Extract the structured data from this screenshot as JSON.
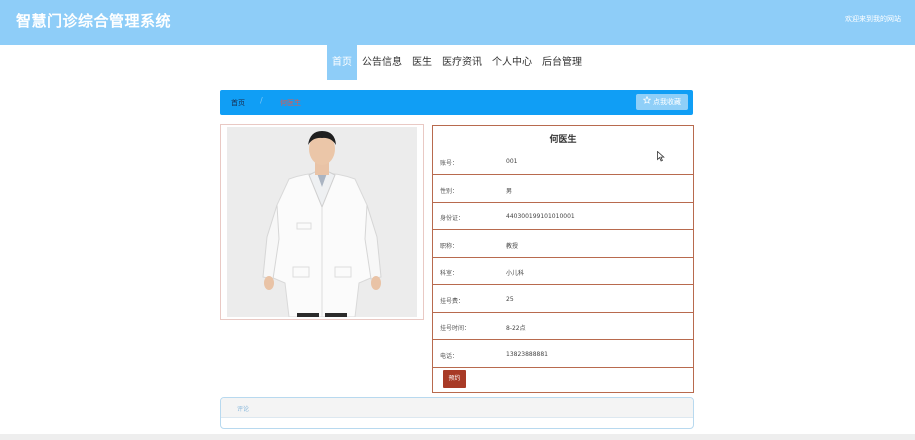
{
  "header": {
    "site_title": "智慧门诊综合管理系统",
    "welcome": "欢迎来到我的网站",
    "bg_color": "#8ecdf8"
  },
  "nav": {
    "items": [
      {
        "label": "首页",
        "active": true
      },
      {
        "label": "公告信息"
      },
      {
        "label": "医生"
      },
      {
        "label": "医疗资讯"
      },
      {
        "label": "个人中心"
      },
      {
        "label": "后台管理"
      }
    ]
  },
  "breadcrumb": {
    "home": "首页",
    "separator": "/",
    "current": "何医生",
    "bg_color": "#109ef5"
  },
  "favorite_button": {
    "icon": "star-outline-icon",
    "label": "点我收藏"
  },
  "doctor": {
    "name": "何医生",
    "fields": [
      {
        "label": "账号：",
        "value": "001"
      },
      {
        "label": "性别：",
        "value": "男"
      },
      {
        "label": "身份证：",
        "value": "440300199101010001"
      },
      {
        "label": "职称：",
        "value": "教授"
      },
      {
        "label": "科室：",
        "value": "小儿科"
      },
      {
        "label": "挂号费：",
        "value": "25"
      },
      {
        "label": "挂号时间：",
        "value": "8-22点"
      },
      {
        "label": "电话：",
        "value": "13823888881"
      }
    ],
    "book_button": "预约",
    "accent_color": "#a83a26"
  },
  "comments": {
    "label": "评论"
  }
}
